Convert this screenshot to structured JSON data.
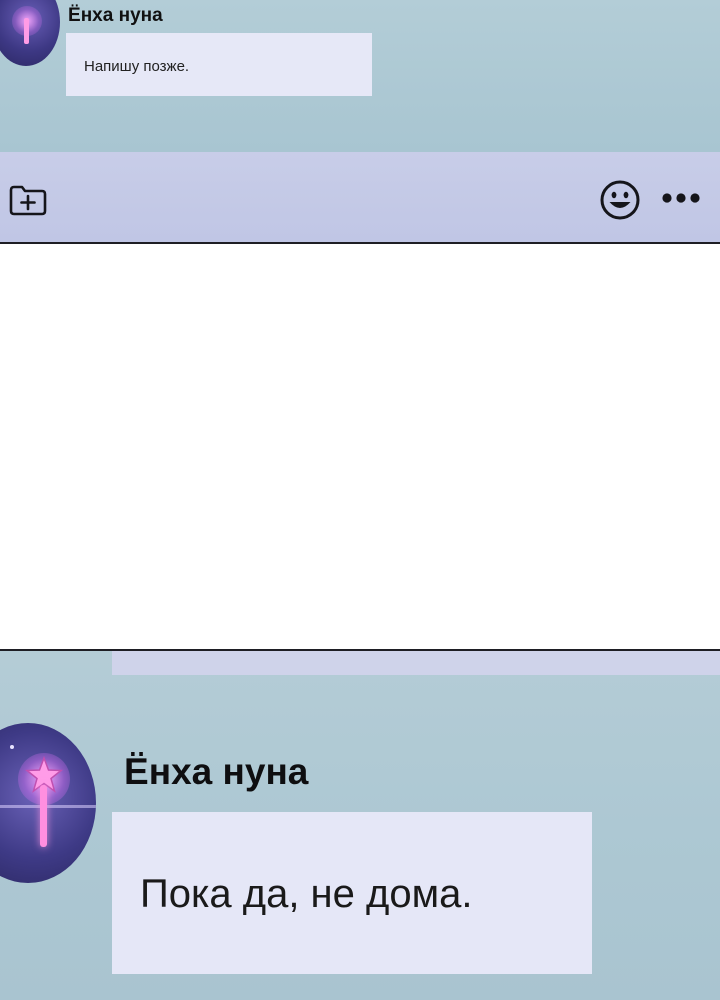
{
  "panel_top": {
    "sender": "Ёнха нуна",
    "message": "Напишу позже.",
    "toolbar": {
      "attach_icon": "folder-plus-icon",
      "emoji_icon": "smiley-icon",
      "more_icon": "more-dots-icon"
    }
  },
  "panel_bottom": {
    "sender": "Ёнха нуна",
    "message": "Пока да, не дома."
  },
  "colors": {
    "chat_background": "#abc6d2",
    "toolbar_background": "#c4c9e6",
    "bubble_background": "#e6e8f7",
    "panel_border": "#1e1e24"
  }
}
